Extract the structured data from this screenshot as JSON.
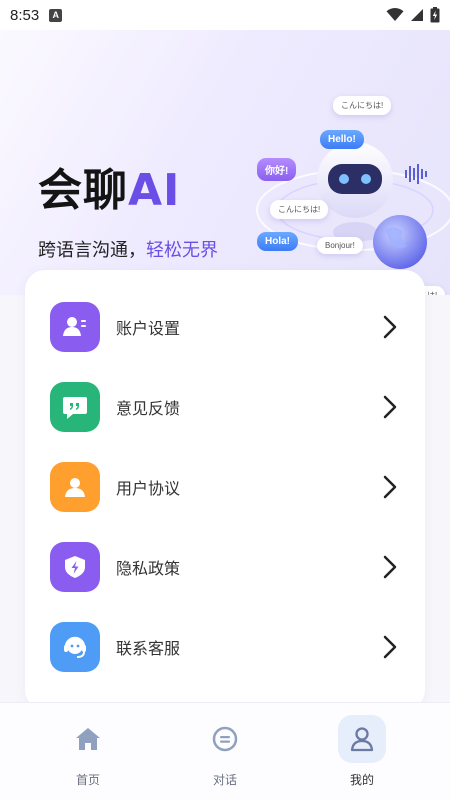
{
  "status_bar": {
    "time": "8:53",
    "notification_icon": "a-notification-icon",
    "icons": [
      "wifi-icon",
      "signal-icon",
      "battery-charging-icon"
    ]
  },
  "hero": {
    "title_main": "会聊",
    "title_accent": "AI",
    "subtitle_main": "跨语言沟通，",
    "subtitle_accent": "轻松无界",
    "bubbles": {
      "konnichiwa_top": "こんにちは!",
      "hello": "Hello!",
      "nihao": "你好!",
      "konnichiwa_mid": "こんにちは!",
      "hola": "Hola!",
      "bonjour": "Bonjour!",
      "konnichiwa_bottom": "こんにちは!"
    },
    "accent_color": "#6b4ee6"
  },
  "menu": {
    "items": [
      {
        "label": "账户设置",
        "icon": "account-settings-icon",
        "color": "#8a5cf0"
      },
      {
        "label": "意见反馈",
        "icon": "feedback-icon",
        "color": "#27b57a"
      },
      {
        "label": "用户协议",
        "icon": "user-agreement-icon",
        "color": "#ff9f2e"
      },
      {
        "label": "隐私政策",
        "icon": "privacy-policy-icon",
        "color": "#8a5cf0"
      },
      {
        "label": "联系客服",
        "icon": "customer-service-icon",
        "color": "#4e9cf5"
      }
    ]
  },
  "bottom_nav": {
    "items": [
      {
        "label": "首页",
        "icon": "home-icon",
        "active": false
      },
      {
        "label": "对话",
        "icon": "chat-icon",
        "active": false
      },
      {
        "label": "我的",
        "icon": "profile-icon",
        "active": true
      }
    ]
  }
}
